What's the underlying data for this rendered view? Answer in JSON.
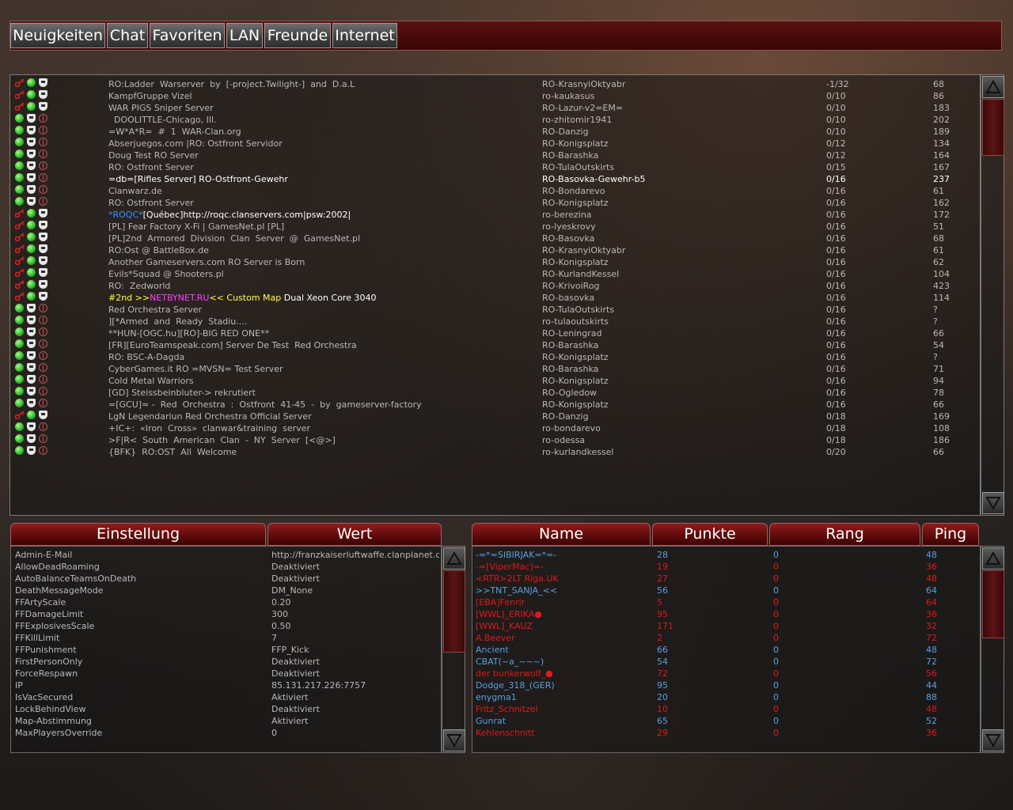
{
  "tabs": [
    {
      "label": "Neuigkeiten"
    },
    {
      "label": "Chat"
    },
    {
      "label": "Favoriten"
    },
    {
      "label": "LAN"
    },
    {
      "label": "Freunde"
    },
    {
      "label": "Internet"
    }
  ],
  "servers": [
    {
      "icons": "kcs",
      "name": "RO:Ladder  Warserver  by  [-project.Twilight-]  and  D.a.L",
      "map": "RO-KrasnyiOktyabr",
      "players": "-1/32",
      "ping": "68"
    },
    {
      "icons": "kcs",
      "name": "KampfGruppe Vizel",
      "map": "ro-kaukasus",
      "players": "0/10",
      "ping": "86"
    },
    {
      "icons": "kcs",
      "name": "WAR PIGS Sniper Server",
      "map": "RO-Lazur-v2=EM=",
      "players": "0/10",
      "ping": "183"
    },
    {
      "icons": "csp",
      "name": "  DOOLITTLE-Chicago, Ill.",
      "map": "ro-zhitomir1941",
      "players": "0/10",
      "ping": "202"
    },
    {
      "icons": "csp",
      "name": "=W*A*R=  #  1  WAR-Clan.org",
      "map": "RO-Danzig",
      "players": "0/10",
      "ping": "189"
    },
    {
      "icons": "csp",
      "name": "Abserjuegos.com |RO: Ostfront Servidor",
      "map": "RO-Konigsplatz",
      "players": "0/12",
      "ping": "134"
    },
    {
      "icons": "csp",
      "name": "Doug Test RO Server",
      "map": "RO-Barashka",
      "players": "0/12",
      "ping": "164"
    },
    {
      "icons": "csp",
      "name": "RO: Ostfront Server",
      "map": "RO-TulaOutskirts",
      "players": "0/15",
      "ping": "167"
    },
    {
      "icons": "csp",
      "name": "=db=[Rifles Server] RO-Ostfront-Gewehr",
      "map": "RO-Basovka-Gewehr-b5",
      "players": "0/16",
      "ping": "237",
      "selected": true
    },
    {
      "icons": "csp",
      "name": "Clanwarz.de",
      "map": "RO-Bondarevo",
      "players": "0/16",
      "ping": "61"
    },
    {
      "icons": "csp",
      "name": "RO: Ostfront Server",
      "map": "RO-Konigsplatz",
      "players": "0/16",
      "ping": "162"
    },
    {
      "icons": "kcs",
      "name": "",
      "map": "ro-berezina",
      "players": "0/16",
      "ping": "172",
      "parts": [
        {
          "t": "*ROQC*",
          "c": "#3a8cff"
        },
        {
          "t": "[Québec]http://roqc.clanservers.com|psw:2002|",
          "c": "#ffffff"
        }
      ]
    },
    {
      "icons": "kcs",
      "name": "[PL] Fear Factory X-Fi | GamesNet.pl [PL]",
      "map": "ro-lyeskrovy",
      "players": "0/16",
      "ping": "51"
    },
    {
      "icons": "kcs",
      "name": "[PL]2nd  Armored  Division  Clan  Server  @  GamesNet.pl",
      "map": "RO-Basovka",
      "players": "0/16",
      "ping": "68"
    },
    {
      "icons": "kcs",
      "name": "RO:Ost @ BattleBox.de",
      "map": "RO-KrasnyiOktyabr",
      "players": "0/16",
      "ping": "61"
    },
    {
      "icons": "kcs",
      "name": "Another Gameservers.com RO Server is Born",
      "map": "RO-Konigsplatz",
      "players": "0/16",
      "ping": "62"
    },
    {
      "icons": "kcs",
      "name": "Evils*Squad @ Shooters.pl",
      "map": "RO-KurlandKessel",
      "players": "0/16",
      "ping": "104"
    },
    {
      "icons": "kcs",
      "name": "RO:  Zedworld",
      "map": "RO-KrivoiRog",
      "players": "0/16",
      "ping": "423"
    },
    {
      "icons": "kcs",
      "name": "",
      "map": "RO-basovka",
      "players": "0/16",
      "ping": "114",
      "parts": [
        {
          "t": "#2nd  >>",
          "c": "#ffff40"
        },
        {
          "t": "NETBYNET.RU",
          "c": "#ff40ff"
        },
        {
          "t": "<<   ",
          "c": "#ffff40"
        },
        {
          "t": "Custom Map ",
          "c": "#ffff40"
        },
        {
          "t": "Dual Xeon Core 3040",
          "c": "#ffffff"
        }
      ]
    },
    {
      "icons": "csp",
      "name": "Red Orchestra Server",
      "map": "RO-TulaOutskirts",
      "players": "0/16",
      "ping": "?"
    },
    {
      "icons": "csp",
      "name": "][*Armed  and  Ready  Stadiu....",
      "map": "ro-tulaoutskirts",
      "players": "0/16",
      "ping": "?"
    },
    {
      "icons": "csp",
      "name": "**HUN-[OGC.hu][RO]-BIG RED ONE**",
      "map": "RO-Leningrad",
      "players": "0/16",
      "ping": "66"
    },
    {
      "icons": "csp",
      "name": "[FR][EuroTeamspeak.com] Server De Test  Red Orchestra",
      "map": "RO-Barashka",
      "players": "0/16",
      "ping": "54"
    },
    {
      "icons": "csp",
      "name": "RO: BSC-A-Dagda",
      "map": "RO-Konigsplatz",
      "players": "0/16",
      "ping": "?"
    },
    {
      "icons": "csp",
      "name": "CyberGames.it RO =MVSN= Test Server",
      "map": "RO-Barashka",
      "players": "0/16",
      "ping": "71"
    },
    {
      "icons": "csp",
      "name": "Cold Metal Warriors",
      "map": "RO-Konigsplatz",
      "players": "0/16",
      "ping": "94"
    },
    {
      "icons": "csp",
      "name": "[GD] Steissbeinbluter-> rekrutiert",
      "map": "RO-Ogledow",
      "players": "0/16",
      "ping": "78"
    },
    {
      "icons": "csp",
      "name": "=[GCU]= -  Red  Orchestra  :  Ostfront  41-45  -  by  gameserver-factory",
      "map": "RO-Konigsplatz",
      "players": "0/16",
      "ping": "66"
    },
    {
      "icons": "kcs",
      "name": "LgN Legendariun Red Orchestra Official Server",
      "map": "RO-Danzig",
      "players": "0/18",
      "ping": "169"
    },
    {
      "icons": "csp",
      "name": "+IC+:  «Iron  Cross»  clanwar&training  server",
      "map": "ro-bondarevo",
      "players": "0/18",
      "ping": "108"
    },
    {
      "icons": "csp",
      "name": ">F|R<  South  American  Clan  -  NY  Server  [<@>]",
      "map": "ro-odessa",
      "players": "0/18",
      "ping": "186"
    },
    {
      "icons": "csp",
      "name": "{BFK}  RO:OST  All  Welcome",
      "map": "ro-kurlandkessel",
      "players": "0/20",
      "ping": "66"
    }
  ],
  "rules_headers": {
    "setting": "Einstellung",
    "value": "Wert"
  },
  "rules": [
    {
      "k": "Admin-E-Mail",
      "v": "http://franzkaiserluftwaffe.clanplanet.de"
    },
    {
      "k": "AllowDeadRoaming",
      "v": "Deaktiviert"
    },
    {
      "k": "AutoBalanceTeamsOnDeath",
      "v": "Deaktiviert"
    },
    {
      "k": "DeathMessageMode",
      "v": "DM_None"
    },
    {
      "k": "FFArtyScale",
      "v": "0.20"
    },
    {
      "k": "FFDamageLimit",
      "v": "300"
    },
    {
      "k": "FFExplosivesScale",
      "v": "0.50"
    },
    {
      "k": "FFKillLimit",
      "v": "7"
    },
    {
      "k": "FFPunishment",
      "v": "FFP_Kick"
    },
    {
      "k": "FirstPersonOnly",
      "v": "Deaktiviert"
    },
    {
      "k": "ForceRespawn",
      "v": "Deaktiviert"
    },
    {
      "k": "IP",
      "v": "85.131.217.226:7757"
    },
    {
      "k": "IsVacSecured",
      "v": "Aktiviert"
    },
    {
      "k": "LockBehindView",
      "v": "Deaktiviert"
    },
    {
      "k": "Map-Abstimmung",
      "v": "Aktiviert"
    },
    {
      "k": "MaxPlayersOverride",
      "v": "0"
    }
  ],
  "player_headers": {
    "name": "Name",
    "score": "Punkte",
    "rank": "Rang",
    "ping": "Ping"
  },
  "players": [
    {
      "name": "-=*=SIBIRJAK=*=-",
      "score": "28",
      "rank": "0",
      "ping": "48",
      "team": "blue"
    },
    {
      "name": "-=[ViperMac]=-",
      "score": "19",
      "rank": "0",
      "ping": "36",
      "team": "red"
    },
    {
      "name": "<RTR>2LT Riga.UK",
      "score": "27",
      "rank": "0",
      "ping": "48",
      "team": "red"
    },
    {
      "name": ">>TNT_SANJA_<<",
      "score": "56",
      "rank": "0",
      "ping": "64",
      "team": "blue"
    },
    {
      "name": "[EBA]Fenrir",
      "score": "5",
      "rank": "0",
      "ping": "64",
      "team": "red"
    },
    {
      "name": "[WWL]_ERIKA●",
      "score": "95",
      "rank": "0",
      "ping": "36",
      "team": "red"
    },
    {
      "name": "[WWL]_KAUZ",
      "score": "171",
      "rank": "0",
      "ping": "32",
      "team": "red"
    },
    {
      "name": "A.Beever",
      "score": "2",
      "rank": "0",
      "ping": "72",
      "team": "red"
    },
    {
      "name": "Ancient",
      "score": "66",
      "rank": "0",
      "ping": "48",
      "team": "blue"
    },
    {
      "name": "CBAT(~a_~~~)",
      "score": "54",
      "rank": "0",
      "ping": "72",
      "team": "blue"
    },
    {
      "name": "der bunkerwolf_●",
      "score": "72",
      "rank": "0",
      "ping": "56",
      "team": "red"
    },
    {
      "name": "Dodge_318_(GER)",
      "score": "95",
      "rank": "0",
      "ping": "44",
      "team": "blue"
    },
    {
      "name": "enygma1",
      "score": "20",
      "rank": "0",
      "ping": "88",
      "team": "blue"
    },
    {
      "name": "Fritz_Schnitzel",
      "score": "10",
      "rank": "0",
      "ping": "48",
      "team": "red"
    },
    {
      "name": "Gunrat",
      "score": "65",
      "rank": "0",
      "ping": "52",
      "team": "blue"
    },
    {
      "name": "Kehlenschnitt",
      "score": "29",
      "rank": "0",
      "ping": "36",
      "team": "red"
    }
  ],
  "colors": {
    "team_blue": "#5a9ee0",
    "team_red": "#dd1a1a",
    "header_red": "#7a1414",
    "selected_text": "#ffffff",
    "text": "#b8b8b8"
  },
  "icon_names": {
    "k": "key-icon",
    "c": "green-status-icon",
    "s": "shield-icon",
    "p": "punkbuster-icon"
  }
}
